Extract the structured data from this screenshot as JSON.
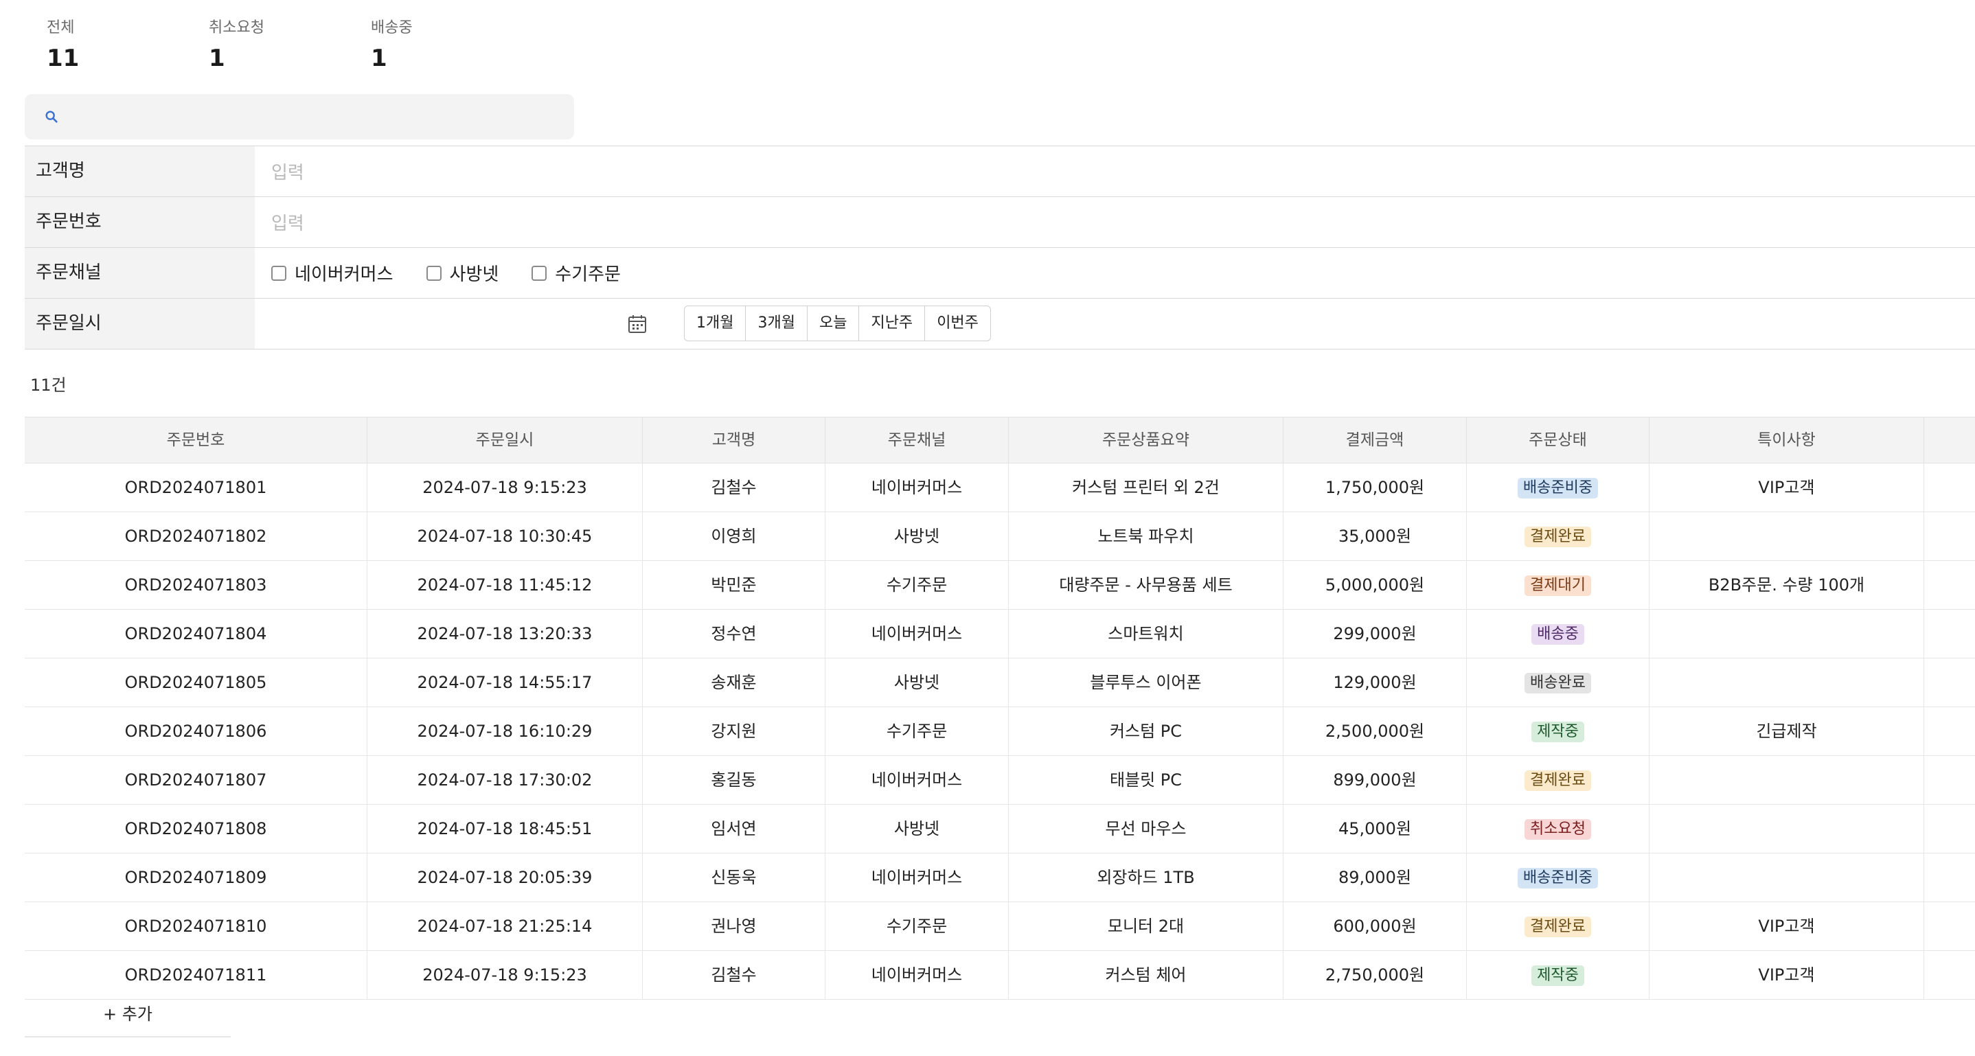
{
  "stats": [
    {
      "label": "전체",
      "value": "11"
    },
    {
      "label": "취소요청",
      "value": "1"
    },
    {
      "label": "배송중",
      "value": "1"
    }
  ],
  "search": {
    "icon": "search-icon",
    "placeholder": ""
  },
  "filters": {
    "customer_name": {
      "label": "고객명",
      "placeholder": "입력"
    },
    "order_number": {
      "label": "주문번호",
      "placeholder": "입력"
    },
    "channel": {
      "label": "주문채널",
      "options": [
        "네이버커머스",
        "사방넷",
        "수기주문"
      ]
    },
    "order_date": {
      "label": "주문일시",
      "icon": "calendar-icon",
      "quick_buttons": [
        "1개월",
        "3개월",
        "오늘",
        "지난주",
        "이번주"
      ]
    }
  },
  "result_count": "11건",
  "table": {
    "headers": [
      "주문번호",
      "주문일시",
      "고객명",
      "주문채널",
      "주문상품요약",
      "결제금액",
      "주문상태",
      "특이사항",
      ""
    ],
    "rows": [
      [
        "ORD2024071801",
        "2024-07-18 9:15:23",
        "김철수",
        "네이버커머스",
        "커스텀 프린터 외 2건",
        "1,750,000원",
        "배송준비중",
        "VIP고객"
      ],
      [
        "ORD2024071802",
        "2024-07-18 10:30:45",
        "이영희",
        "사방넷",
        "노트북 파우치",
        "35,000원",
        "결제완료",
        ""
      ],
      [
        "ORD2024071803",
        "2024-07-18 11:45:12",
        "박민준",
        "수기주문",
        "대량주문 - 사무용품 세트",
        "5,000,000원",
        "결제대기",
        "B2B주문. 수량 100개"
      ],
      [
        "ORD2024071804",
        "2024-07-18 13:20:33",
        "정수연",
        "네이버커머스",
        "스마트워치",
        "299,000원",
        "배송중",
        ""
      ],
      [
        "ORD2024071805",
        "2024-07-18 14:55:17",
        "송재훈",
        "사방넷",
        "블루투스 이어폰",
        "129,000원",
        "배송완료",
        ""
      ],
      [
        "ORD2024071806",
        "2024-07-18 16:10:29",
        "강지원",
        "수기주문",
        "커스텀 PC",
        "2,500,000원",
        "제작중",
        "긴급제작"
      ],
      [
        "ORD2024071807",
        "2024-07-18 17:30:02",
        "홍길동",
        "네이버커머스",
        "태블릿 PC",
        "899,000원",
        "결제완료",
        ""
      ],
      [
        "ORD2024071808",
        "2024-07-18 18:45:51",
        "임서연",
        "사방넷",
        "무선 마우스",
        "45,000원",
        "취소요청",
        ""
      ],
      [
        "ORD2024071809",
        "2024-07-18 20:05:39",
        "신동욱",
        "네이버커머스",
        "외장하드 1TB",
        "89,000원",
        "배송준비중",
        ""
      ],
      [
        "ORD2024071810",
        "2024-07-18 21:25:14",
        "권나영",
        "수기주문",
        "모니터 2대",
        "600,000원",
        "결제완료",
        "VIP고객"
      ],
      [
        "ORD2024071811",
        "2024-07-18 9:15:23",
        "김철수",
        "네이버커머스",
        "커스텀 체어",
        "2,750,000원",
        "제작중",
        "VIP고객"
      ]
    ],
    "status_colors": {
      "배송준비중": {
        "bg": "#d3e5f5",
        "fg": "#1f3a5c"
      },
      "결제완료": {
        "bg": "#fbeacb",
        "fg": "#6b4b12"
      },
      "결제대기": {
        "bg": "#fbe0cf",
        "fg": "#7a3a12"
      },
      "배송중": {
        "bg": "#e9dcf2",
        "fg": "#4f2a66"
      },
      "배송완료": {
        "bg": "#e4e4e4",
        "fg": "#333333"
      },
      "제작중": {
        "bg": "#d7eddc",
        "fg": "#1e5a2e"
      },
      "취소요청": {
        "bg": "#f8d6d6",
        "fg": "#7a1f1f"
      }
    }
  },
  "add_label": "+ 추가",
  "colors": {
    "accent": "#3b6fd8"
  }
}
